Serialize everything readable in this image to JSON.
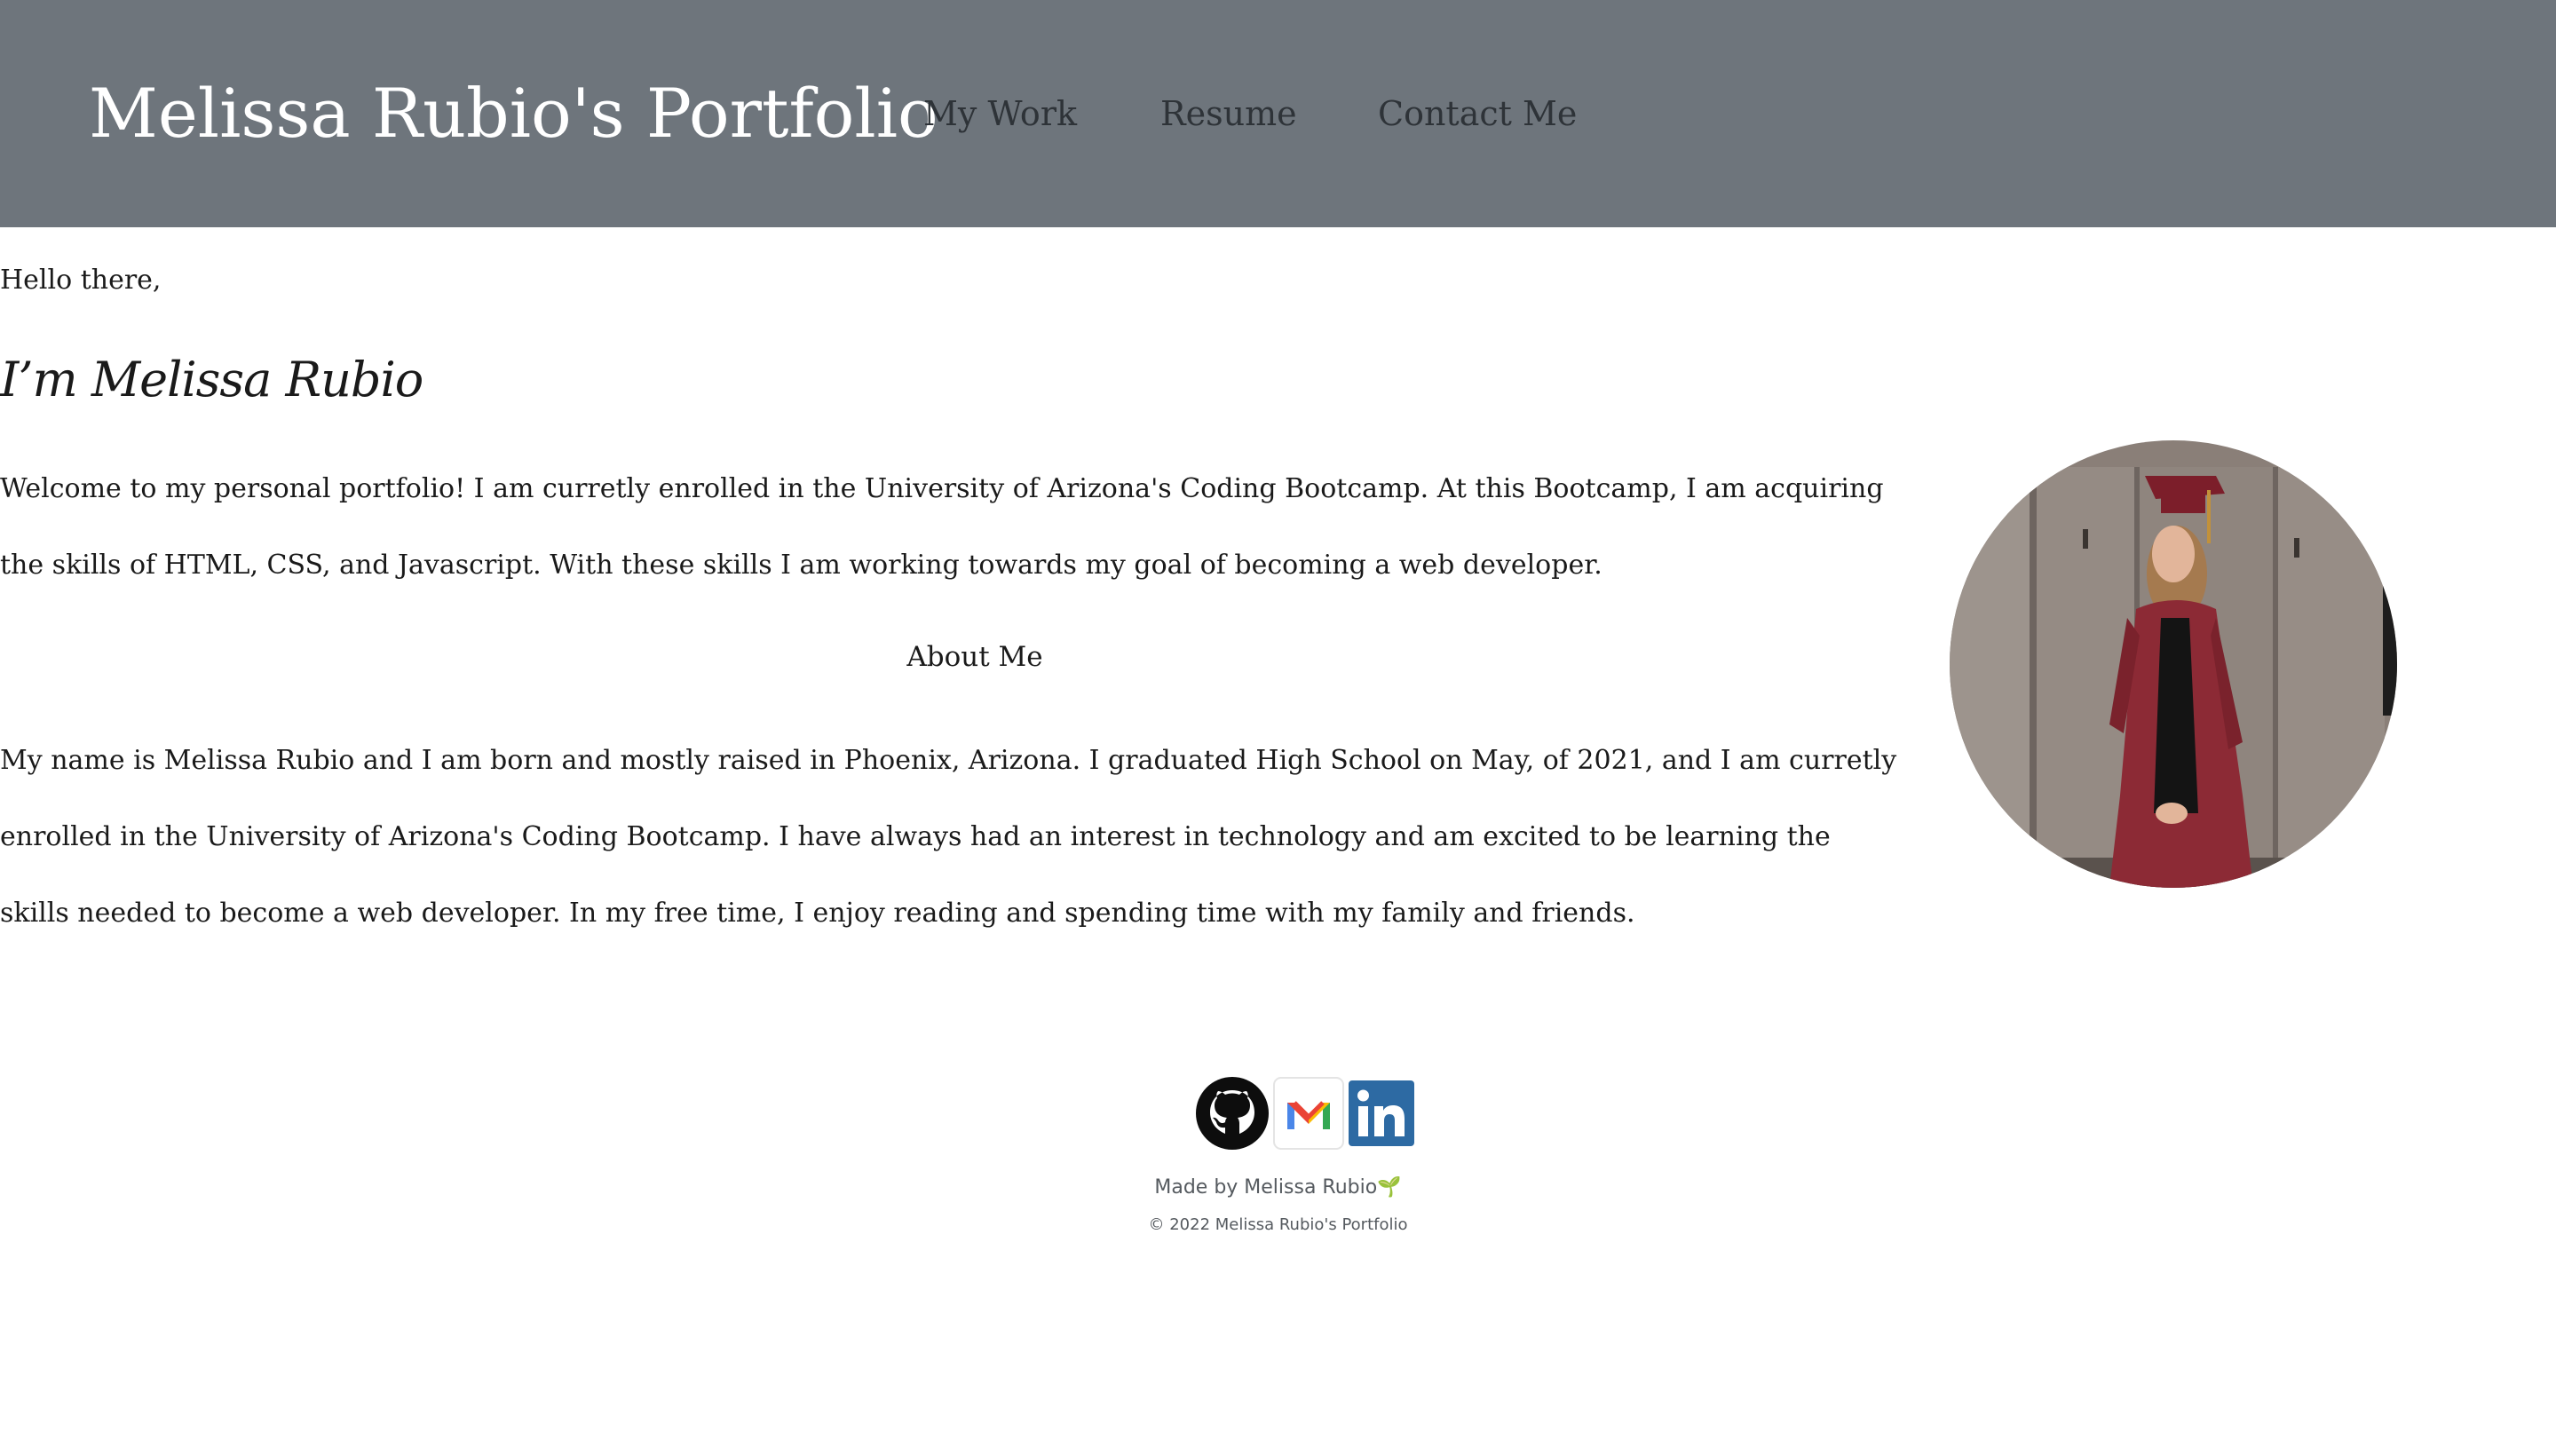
{
  "header": {
    "title": "Melissa Rubio's Portfolio",
    "nav": [
      "My Work",
      "Resume",
      "Contact Me"
    ]
  },
  "main": {
    "greeting": "Hello there,",
    "name_heading": "I’m Melissa Rubio",
    "intro": "Welcome to my personal portfolio! I am curretly enrolled in the University of Arizona's Coding Bootcamp. At this Bootcamp, I am acquiring the skills of HTML, CSS, and Javascript. With these skills I am working towards my goal of becoming a web developer.",
    "about_heading": "About Me",
    "about_text": "My name is Melissa Rubio and I am born and mostly raised in Phoenix, Arizona. I graduated High School on May, of 2021, and I am curretly enrolled in the University of Arizona's Coding Bootcamp. I have always had an interest in technology and am excited to be learning the skills needed to become a web developer. In my free time, I enjoy reading and spending time with my family and friends."
  },
  "social": [
    {
      "icon": "github-icon"
    },
    {
      "icon": "gmail-icon"
    },
    {
      "icon": "linkedin-icon"
    }
  ],
  "footer": {
    "made_by": "Made by Melissa Rubio",
    "sprout": "🌱",
    "copyright": "© 2022 Melissa Rubio's Portfolio"
  },
  "colors": {
    "header_bg": "#6e757c",
    "linkedin": "#2d6aa3",
    "gown": "#8c2a35"
  }
}
